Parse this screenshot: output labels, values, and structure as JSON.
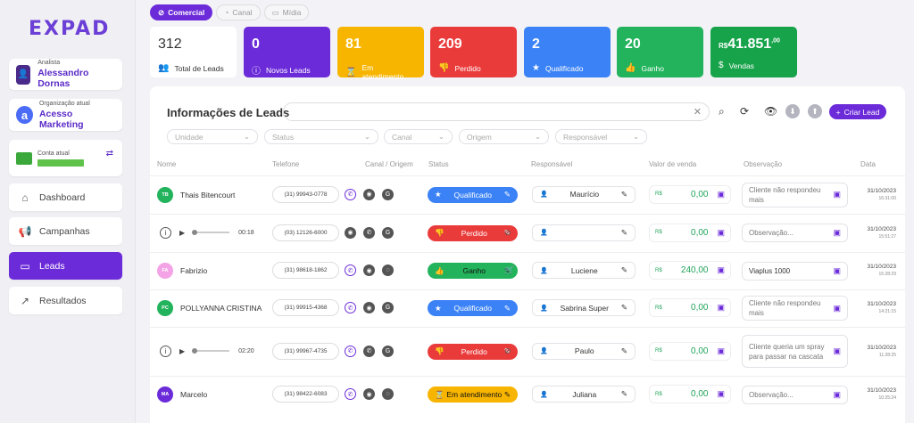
{
  "app": {
    "logo": "EXPAD"
  },
  "sidebar": {
    "analyst": {
      "label": "Analista",
      "name": "Alessandro Dornas"
    },
    "org": {
      "label": "Organização atual",
      "name": "Acesso Marketing",
      "logo_letter": "a"
    },
    "account": {
      "label": "Conta atual"
    },
    "nav": [
      {
        "label": "Dashboard",
        "icon": "home-icon"
      },
      {
        "label": "Campanhas",
        "icon": "megaphone-icon"
      },
      {
        "label": "Leads",
        "icon": "chat-icon",
        "active": true
      },
      {
        "label": "Resultados",
        "icon": "chart-icon"
      }
    ]
  },
  "tabs": [
    {
      "label": "Comercial",
      "active": true
    },
    {
      "label": "Canal"
    },
    {
      "label": "Mídia"
    }
  ],
  "stats": [
    {
      "value": "312",
      "label": "Total de Leads",
      "color": "#ffffff"
    },
    {
      "value": "0",
      "label": "Novos Leads",
      "color": "#6c2bd9"
    },
    {
      "value": "81",
      "label": "Em atendimento",
      "color": "#f7b500"
    },
    {
      "value": "209",
      "label": "Perdido",
      "color": "#ea3b3b"
    },
    {
      "value": "2",
      "label": "Qualificado",
      "color": "#3b82f6"
    },
    {
      "value": "20",
      "label": "Ganho",
      "color": "#22b35c"
    },
    {
      "value_prefix": "R$",
      "value": "41.851",
      "value_sup": ",00",
      "label": "Vendas",
      "color": "#16a34a"
    }
  ],
  "panel": {
    "title": "Informações de Leads",
    "create_button": "Criar Lead",
    "filters": [
      "Unidade",
      "Status",
      "Canal",
      "Origem",
      "Responsável"
    ],
    "columns": [
      "Nome",
      "Telefone",
      "Canal / Origem",
      "Status",
      "Responsável",
      "Valor de venda",
      "Observação",
      "Data"
    ]
  },
  "rows": [
    {
      "initials": "TB",
      "avatar_color": "#22b35c",
      "name": "Thais Bitencourt",
      "phone": "(31) 99943-0778",
      "channels": [
        "wa",
        "gr",
        "g"
      ],
      "status": "Qualificado",
      "status_color": "#3b82f6",
      "status_white": true,
      "resp": "Maurício",
      "currency": "R$",
      "value": "0,00",
      "obs": "Cliente não respondeu mais",
      "date": "31/10/2023",
      "time": "16:31:00"
    },
    {
      "audio": true,
      "duration": "00:18",
      "phone": "(03) 12126-6000",
      "channels": [
        "gr",
        "phone",
        "g"
      ],
      "status": "Perdido",
      "status_color": "#ea3b3b",
      "status_white": true,
      "extra": "⊘",
      "resp": "",
      "currency": "R$",
      "value": "0,00",
      "obs": "Observação...",
      "date": "31/10/2023",
      "time": "15:51:27"
    },
    {
      "initials": "FA",
      "avatar_color": "#f3a3e6",
      "name": "Fabrizio",
      "phone": "(31) 98618-1862",
      "channels": [
        "wa",
        "gr",
        "gr2"
      ],
      "status": "Ganho",
      "status_color": "#22b35c",
      "status_white": false,
      "extra": "🛒",
      "resp": "Luciene",
      "currency": "R$",
      "value": "240,00",
      "obs": "Viaplus 1000",
      "date": "31/10/2023",
      "time": "15:28:29"
    },
    {
      "initials": "PC",
      "avatar_color": "#22b35c",
      "name": "POLLYANNA CRISTINA",
      "phone": "(31) 99915-4368",
      "channels": [
        "wa",
        "gr",
        "g"
      ],
      "status": "Qualificado",
      "status_color": "#3b82f6",
      "status_white": true,
      "resp": "Sabrina Super",
      "currency": "R$",
      "value": "0,00",
      "obs": "Cliente não respondeu mais",
      "date": "31/10/2023",
      "time": "14:21:15"
    },
    {
      "audio": true,
      "duration": "02:20",
      "phone": "(31) 99967-4735",
      "channels": [
        "wa",
        "phone",
        "g"
      ],
      "status": "Perdido",
      "status_color": "#ea3b3b",
      "status_white": true,
      "extra": "⊘",
      "resp": "Paulo",
      "currency": "R$",
      "value": "0,00",
      "obs": "Cliente queria um spray para passar na cascata",
      "date": "31/10/2023",
      "time": "11:28:25"
    },
    {
      "initials": "MA",
      "avatar_color": "#6c2bd9",
      "name": "Marcelo",
      "phone": "(31) 98422-6083",
      "channels": [
        "wa",
        "gr",
        "gr2"
      ],
      "status": "Em atendimento",
      "status_color": "#f7b500",
      "status_white": false,
      "resp": "Juliana",
      "currency": "R$",
      "value": "0,00",
      "obs": "Observação...",
      "date": "31/10/2023",
      "time": "10:25:24"
    }
  ]
}
